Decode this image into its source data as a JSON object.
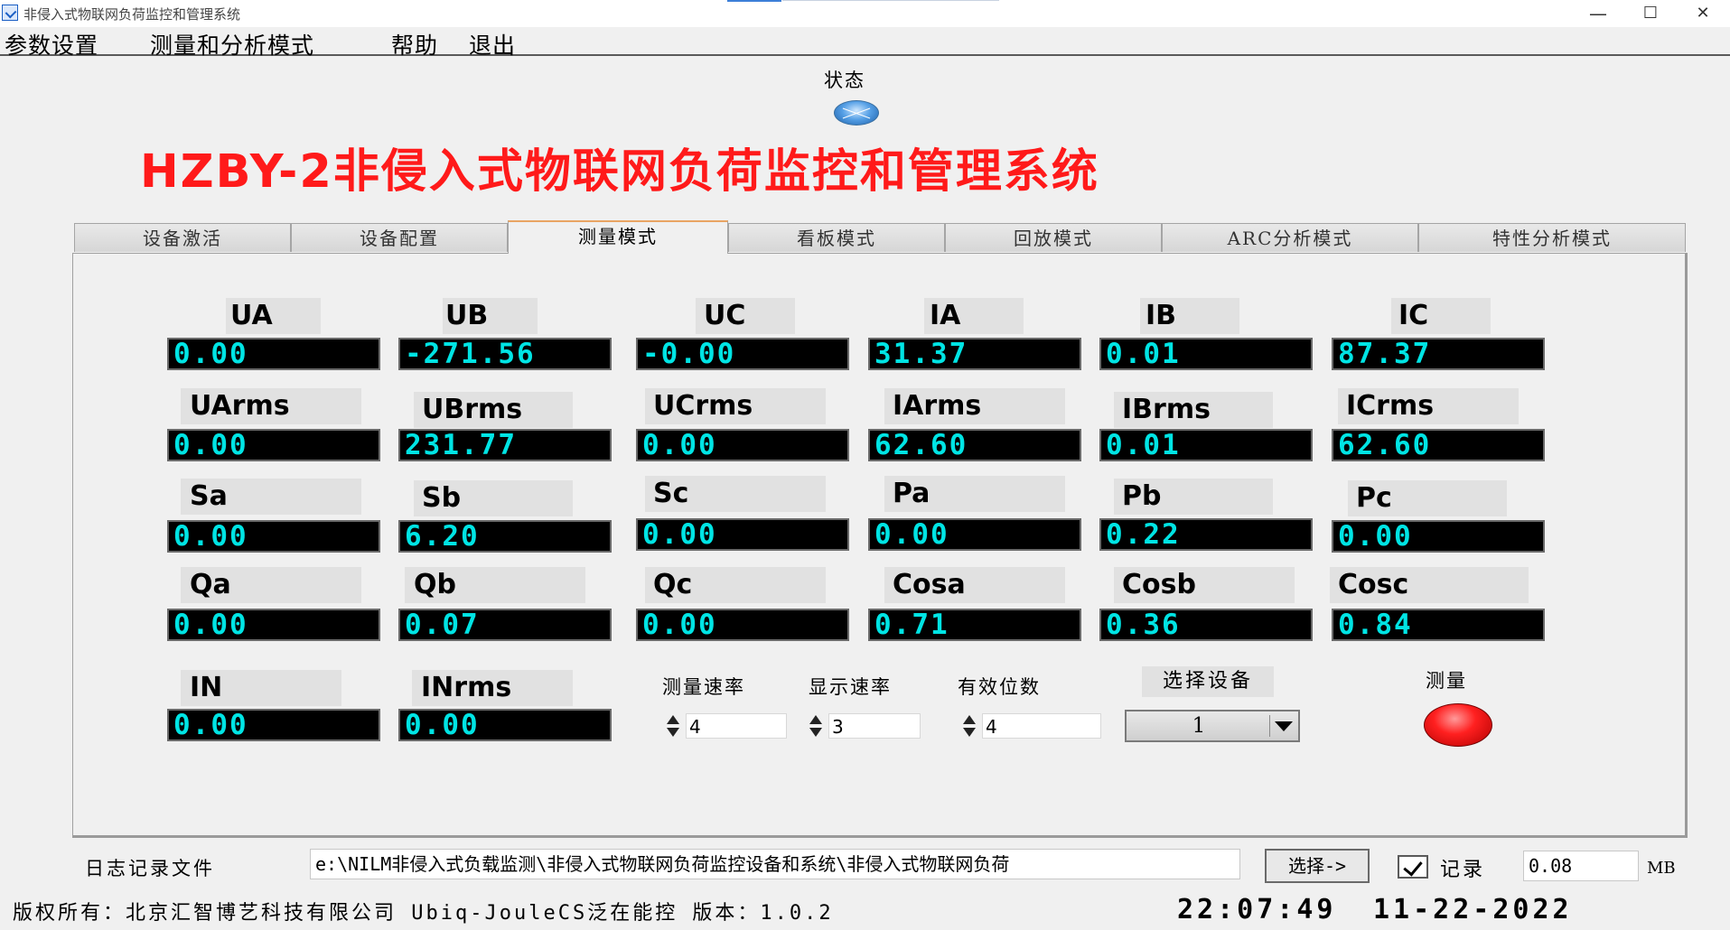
{
  "window": {
    "title": "非侵入式物联网负荷监控和管理系统",
    "minimize": "—",
    "maximize": "☐",
    "close": "✕"
  },
  "menu": [
    "参数设置",
    "测量和分析模式",
    "帮助",
    "退出"
  ],
  "status_label": "状态",
  "main_title": "HZBY-2非侵入式物联网负荷监控和管理系统",
  "tabs": [
    "设备激活",
    "设备配置",
    "测量模式",
    "看板模式",
    "回放模式",
    "ARC分析模式",
    "特性分析模式"
  ],
  "active_tab": "测量模式",
  "measurements": {
    "row1": [
      {
        "label": "UA",
        "value": "0.00"
      },
      {
        "label": "UB",
        "value": "-271.56"
      },
      {
        "label": "UC",
        "value": "-0.00"
      },
      {
        "label": "IA",
        "value": "31.37"
      },
      {
        "label": "IB",
        "value": "0.01"
      },
      {
        "label": "IC",
        "value": "87.37"
      }
    ],
    "row2": [
      {
        "label": "UArms",
        "value": "0.00"
      },
      {
        "label": "UBrms",
        "value": "231.77"
      },
      {
        "label": "UCrms",
        "value": "0.00"
      },
      {
        "label": "IArms",
        "value": "62.60"
      },
      {
        "label": "IBrms",
        "value": "0.01"
      },
      {
        "label": "ICrms",
        "value": "62.60"
      }
    ],
    "row3": [
      {
        "label": "Sa",
        "value": "0.00"
      },
      {
        "label": "Sb",
        "value": "6.20"
      },
      {
        "label": "Sc",
        "value": "0.00"
      },
      {
        "label": "Pa",
        "value": "0.00"
      },
      {
        "label": "Pb",
        "value": "0.22"
      },
      {
        "label": "Pc",
        "value": "0.00"
      }
    ],
    "row4": [
      {
        "label": "Qa",
        "value": "0.00"
      },
      {
        "label": "Qb",
        "value": "0.07"
      },
      {
        "label": "Qc",
        "value": "0.00"
      },
      {
        "label": "Cosa",
        "value": "0.71"
      },
      {
        "label": "Cosb",
        "value": "0.36"
      },
      {
        "label": "Cosc",
        "value": "0.84"
      }
    ],
    "row5": [
      {
        "label": "IN",
        "value": "0.00"
      },
      {
        "label": "INrms",
        "value": "0.00"
      }
    ]
  },
  "controls": {
    "measure_rate": {
      "label": "测量速率",
      "value": "4"
    },
    "display_rate": {
      "label": "显示速率",
      "value": "3"
    },
    "significant_digits": {
      "label": "有效位数",
      "value": "4"
    },
    "select_device": {
      "label": "选择设备",
      "value": "1"
    },
    "measure": {
      "label": "测量"
    }
  },
  "log": {
    "label": "日志记录文件",
    "path": "e:\\NILM非侵入式负载监测\\非侵入式物联网负荷监控设备和系统\\非侵入式物联网负荷",
    "choose_label": "选择->",
    "record_label": "记录",
    "record_checked": true,
    "size_value": "0.08",
    "size_unit": "MB"
  },
  "footer": {
    "copyright": "版权所有：北京汇智博艺科技有限公司 Ubiq-JouleCS泛在能控 版本：1.0.2",
    "time": "22:07:49",
    "date": "11-22-2022"
  },
  "colors": {
    "title_red": "#ff1a1a",
    "digit_cyan": "#00e4e4",
    "digit_bg": "#000000",
    "tab_active_accent": "#e9a463",
    "measure_led": "#ff2020"
  }
}
